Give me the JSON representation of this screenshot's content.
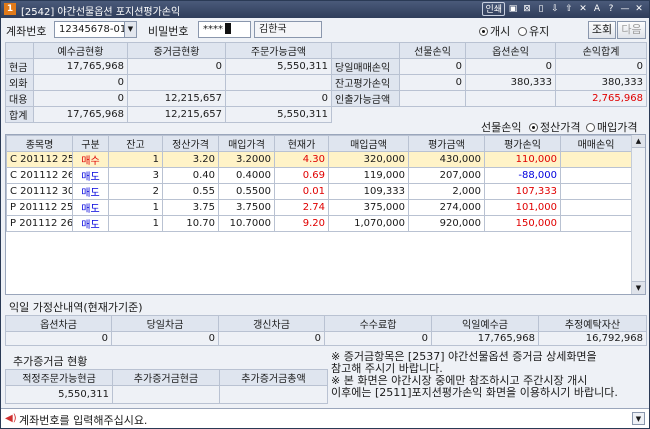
{
  "titlebar": {
    "badge": "1",
    "title": "[2542] 야간선물옵션 포지션평가손익",
    "tools": [
      "인쇄",
      "▣",
      "⊠",
      "▯",
      "⇩",
      "⇧",
      "✕",
      "A",
      "?",
      "—",
      "✕"
    ]
  },
  "account": {
    "label": "계좌번호",
    "number": "12345678-01",
    "pw_label": "비밀번호",
    "pw_value": "****",
    "owner": "김한국",
    "radio_open": "개시",
    "radio_keep": "유지",
    "btn_query": "조회",
    "btn_next": "다음"
  },
  "summary": {
    "headers": [
      "",
      "예수금현황",
      "증거금현황",
      "주문가능금액"
    ],
    "rows": [
      {
        "label": "현금",
        "v1": "17,765,968",
        "v2": "0",
        "v3": "5,550,311"
      },
      {
        "label": "외화",
        "v1": "0",
        "v2": "",
        "v3": ""
      },
      {
        "label": "대용",
        "v1": "0",
        "v2": "12,215,657",
        "v3": "0"
      },
      {
        "label": "합계",
        "v1": "17,765,968",
        "v2": "12,215,657",
        "v3": "5,550,311"
      }
    ]
  },
  "pnl": {
    "headers": [
      "",
      "선물손익",
      "옵션손익",
      "손익합계"
    ],
    "rows": [
      {
        "label": "당일매매손익",
        "v1": "0",
        "v2": "0",
        "v3": "0"
      },
      {
        "label": "잔고평가손익",
        "v1": "0",
        "v2": "380,333",
        "v3": "380,333"
      },
      {
        "label": "인출가능금액",
        "v1": "",
        "v2": "",
        "v3": "2,765,968"
      }
    ]
  },
  "price_option": {
    "label": "선물손익",
    "opt_settle": "정산가격",
    "opt_buy": "매입가격"
  },
  "positions": {
    "headers": [
      "종목명",
      "구분",
      "잔고",
      "정산가격",
      "매입가격",
      "현재가",
      "매입금액",
      "평가금액",
      "평가손익",
      "매매손익"
    ],
    "rows": [
      {
        "name": "C 201112 25",
        "side": "매수",
        "qty": "1",
        "settle": "3.20",
        "buy": "3.2000",
        "cur": "4.30",
        "buyamt": "320,000",
        "evalamt": "430,000",
        "pnl": "110,000",
        "tpnl": ""
      },
      {
        "name": "C 201112 26",
        "side": "매도",
        "qty": "3",
        "settle": "0.40",
        "buy": "0.4000",
        "cur": "0.69",
        "buyamt": "119,000",
        "evalamt": "207,000",
        "pnl": "-88,000",
        "tpnl": ""
      },
      {
        "name": "C 201112 30",
        "side": "매도",
        "qty": "2",
        "settle": "0.55",
        "buy": "0.5500",
        "cur": "0.01",
        "buyamt": "109,333",
        "evalamt": "2,000",
        "pnl": "107,333",
        "tpnl": ""
      },
      {
        "name": "P 201112 25",
        "side": "매도",
        "qty": "1",
        "settle": "3.75",
        "buy": "3.7500",
        "cur": "2.74",
        "buyamt": "375,000",
        "evalamt": "274,000",
        "pnl": "101,000",
        "tpnl": ""
      },
      {
        "name": "P 201112 26",
        "side": "매도",
        "qty": "1",
        "settle": "10.70",
        "buy": "10.7000",
        "cur": "9.20",
        "buyamt": "1,070,000",
        "evalamt": "920,000",
        "pnl": "150,000",
        "tpnl": ""
      }
    ]
  },
  "nextday": {
    "title": "익일 가정산내역(현재가기준)",
    "headers": [
      "옵션차금",
      "당일차금",
      "갱신차금",
      "수수료합",
      "익일예수금",
      "추정예탁자산"
    ],
    "values": [
      "0",
      "0",
      "0",
      "0",
      "17,765,968",
      "16,792,968"
    ]
  },
  "extra_margin": {
    "title": "추가증거금 현황",
    "headers": [
      "적정주문가능현금",
      "추가증거금현금",
      "추가증거금총액"
    ],
    "values": [
      "5,550,311",
      "",
      ""
    ]
  },
  "notes": [
    "※ 증거금항목은 [2537] 야간선물옵션 증거금 상세화면을",
    "   참고해 주시기 바랍니다.",
    "※ 본 화면은 야간시장 중에만 참조하시고 주간시장 개시",
    "   이후에는 [2511]포지션평가손익 화면을 이용하시기 바랍니다."
  ],
  "status": {
    "message": "계좌번호를 입력해주십시요."
  },
  "colors": {
    "buy": "#e00000",
    "sell": "#0000dd",
    "selected_row": "#fff3c7"
  }
}
